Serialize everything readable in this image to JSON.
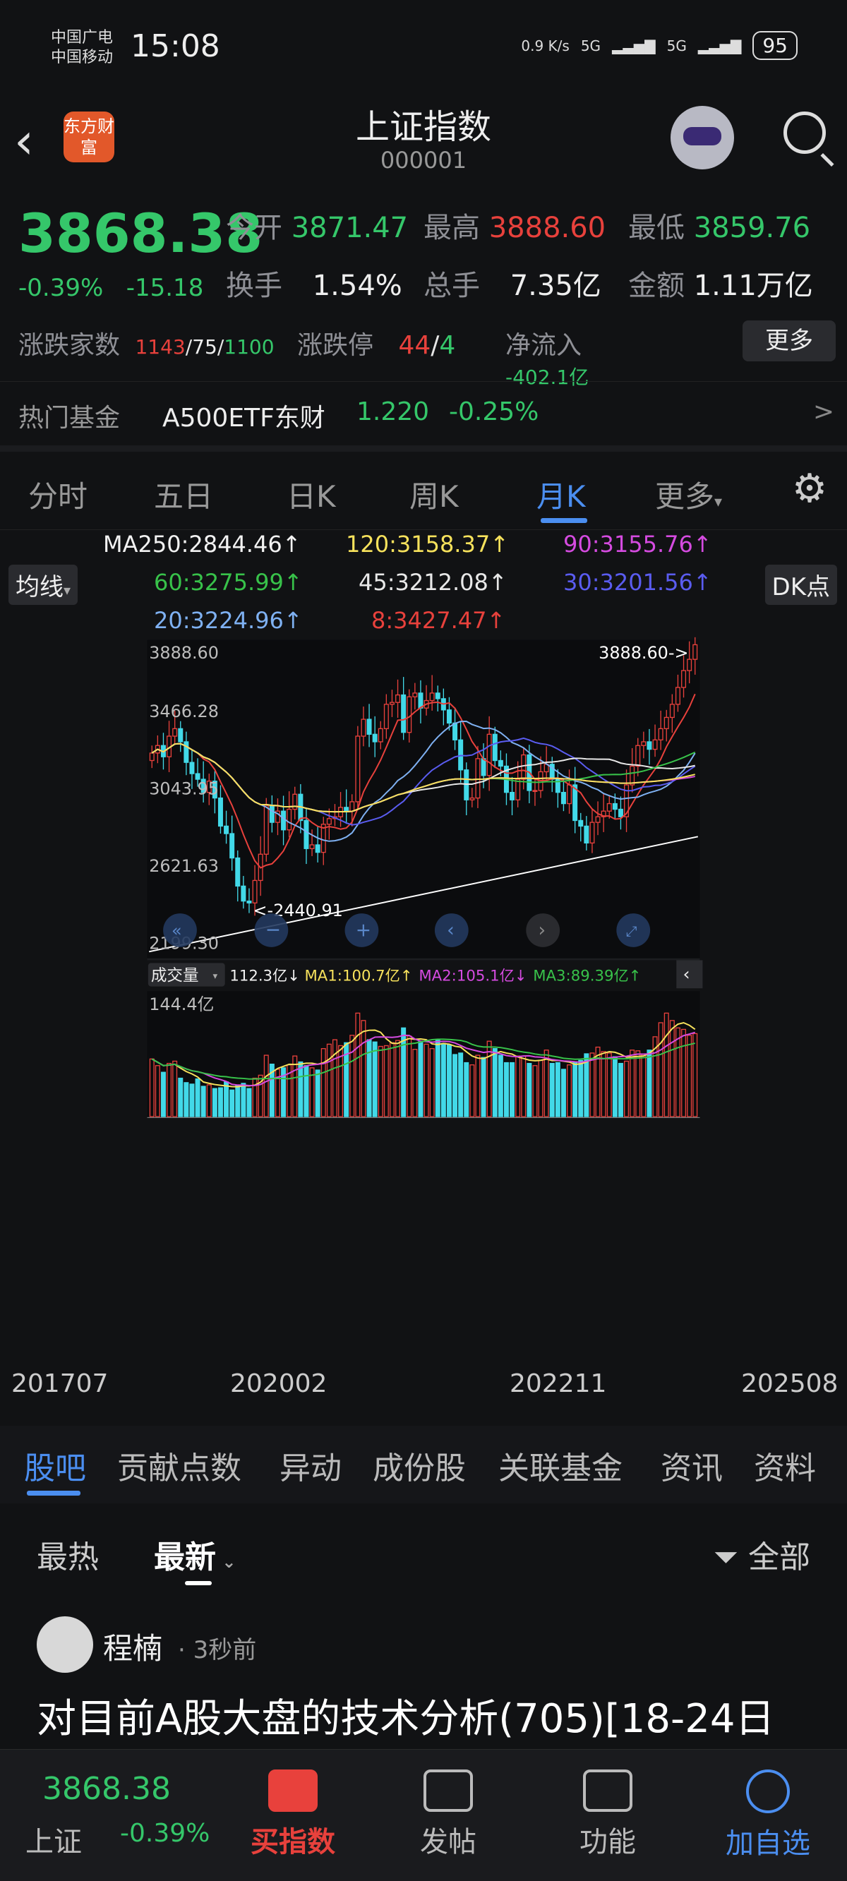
{
  "status_bar": {
    "carrier1": "中国广电",
    "carrier2": "中国移动",
    "time": "15:08",
    "net_speed": "0.9 K/s",
    "sig1": "5G",
    "sig2": "5G",
    "battery": "95"
  },
  "header": {
    "logo_text": "东方财富",
    "title": "上证指数",
    "code": "000001"
  },
  "quote": {
    "price": "3868.38",
    "change_pct": "-0.39%",
    "change_abs": "-15.18",
    "open_label": "今开",
    "open": "3871.47",
    "high_label": "最高",
    "high": "3888.60",
    "low_label": "最低",
    "low": "3859.76",
    "turnover_label": "换手",
    "turnover": "1.54%",
    "volume_label": "总手",
    "volume": "7.35亿",
    "amount_label": "金额",
    "amount": "1.11万亿",
    "breadth_label": "涨跌家数",
    "breadth_up": "1143",
    "breadth_flat": "75",
    "breadth_down": "1100",
    "limit_label": "涨跌停",
    "limit_up": "44",
    "limit_down": "4",
    "inflow_label": "净流入",
    "inflow": "-402.1亿",
    "more": "更多"
  },
  "fund": {
    "label": "热门基金",
    "name": "A500ETF东财",
    "price": "1.220",
    "chg": "-0.25%",
    "arrow": ">"
  },
  "tabs": [
    "分时",
    "五日",
    "日K",
    "周K",
    "月K",
    "更多"
  ],
  "ma_chip": "均线",
  "dk_chip": "DK点",
  "ma_legend": {
    "ma250": "MA250:2844.46↑",
    "ma120": "120:3158.37↑",
    "ma90": "90:3155.76↑",
    "ma60": "60:3275.99↑",
    "ma45": "45:3212.08↑",
    "ma30": "30:3201.56↑",
    "ma20": "20:3224.96↑",
    "ma8": "8:3427.47↑"
  },
  "price_axis": [
    "3888.60",
    "3466.28",
    "3043.95",
    "2621.63",
    "2199.30"
  ],
  "annotations": {
    "high": "3888.60->",
    "low": "<-2440.91"
  },
  "volume_bar": {
    "chip": "成交量",
    "value": "112.3亿↓",
    "ma1": "MA1:100.7亿↑",
    "ma2": "MA2:105.1亿↓",
    "ma3": "MA3:89.39亿↑",
    "max": "144.4亿"
  },
  "x_axis": [
    "201707",
    "202002",
    "202211",
    "202508"
  ],
  "chart_data": {
    "type": "candlestick",
    "ylim": [
      2199.3,
      3888.6
    ],
    "volume_max": 144.4,
    "closes": [
      3290,
      3330,
      3270,
      3380,
      3420,
      3350,
      3240,
      3180,
      3150,
      3080,
      3140,
      3050,
      2900,
      2860,
      2730,
      2580,
      2500,
      2490,
      2610,
      2750,
      3010,
      2920,
      2980,
      2880,
      2990,
      3070,
      2930,
      2780,
      2800,
      2760,
      2910,
      2940,
      2950,
      3000,
      2980,
      3030,
      3380,
      3470,
      3390,
      3350,
      3420,
      3550,
      3560,
      3600,
      3400,
      3590,
      3610,
      3530,
      3570,
      3610,
      3580,
      3520,
      3450,
      3360,
      3200,
      3040,
      3050,
      3260,
      3170,
      3390,
      3250,
      3220,
      3080,
      3040,
      3150,
      3280,
      3090,
      3090,
      3190,
      3230,
      3150,
      3080,
      3020,
      3120,
      2930,
      2900,
      2810,
      2920,
      2950,
      2980,
      3020,
      2990,
      2950,
      3120,
      3220,
      3330,
      3350,
      3310,
      3360,
      3420,
      3480,
      3550,
      3640,
      3730,
      3790,
      3868
    ],
    "volumes": [
      78,
      69,
      60,
      72,
      75,
      52,
      46,
      44,
      51,
      41,
      43,
      38,
      39,
      47,
      36,
      42,
      45,
      38,
      52,
      56,
      83,
      71,
      64,
      66,
      70,
      82,
      74,
      69,
      66,
      63,
      92,
      98,
      104,
      96,
      100,
      110,
      140,
      130,
      104,
      101,
      95,
      96,
      100,
      103,
      120,
      109,
      91,
      102,
      98,
      92,
      104,
      99,
      97,
      84,
      86,
      73,
      70,
      83,
      80,
      102,
      92,
      83,
      73,
      73,
      82,
      82,
      72,
      69,
      76,
      90,
      72,
      73,
      64,
      70,
      74,
      76,
      85,
      86,
      94,
      88,
      86,
      81,
      72,
      75,
      90,
      89,
      84,
      90,
      108,
      127,
      140,
      130,
      120,
      118,
      110,
      112.3
    ]
  },
  "sub_tabs": [
    "股吧",
    "贡献点数",
    "异动",
    "成份股",
    "关联基金",
    "资讯",
    "资料"
  ],
  "sort": {
    "hot": "最热",
    "latest": "最新",
    "filter": "全部"
  },
  "post": {
    "author": "程楠",
    "time": "· 3秒前",
    "title": "对目前A股大盘的技术分析(705)[18-24日"
  },
  "bottom_bar": {
    "index_price": "3868.38",
    "index_name": "上证",
    "index_chg": "-0.39%",
    "buy": "买指数",
    "post": "发帖",
    "features": "功能",
    "add": "加自选"
  }
}
